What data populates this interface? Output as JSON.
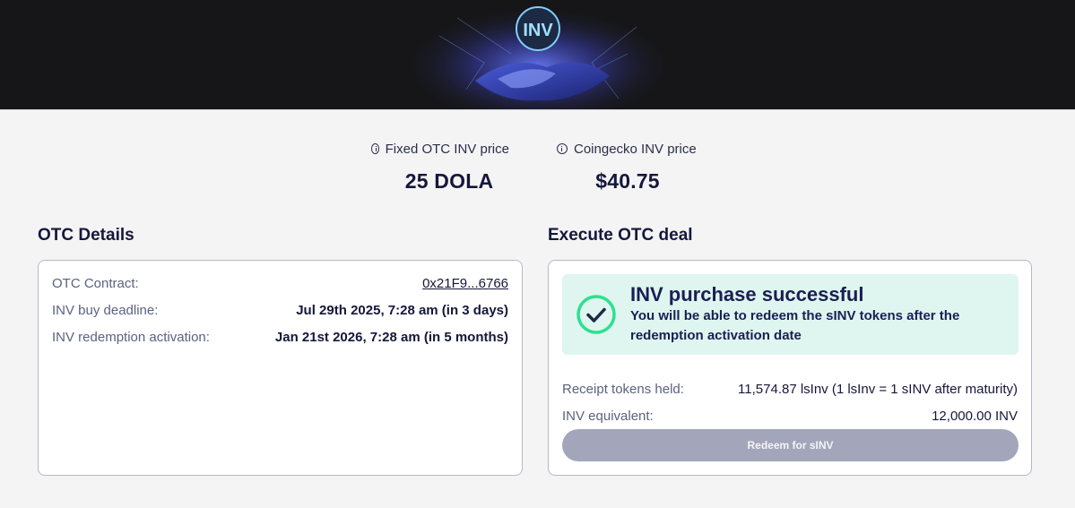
{
  "banner": {
    "icon": "handshake-logo-banner"
  },
  "prices": [
    {
      "label": "Fixed OTC INV price",
      "value": "25 DOLA",
      "icon": "info-icon"
    },
    {
      "label": "Coingecko INV price",
      "value": "$40.75",
      "icon": "info-icon"
    }
  ],
  "otc_details": {
    "title": "OTC Details",
    "rows": [
      {
        "label": "OTC Contract:",
        "value": "0x21F9...6766"
      },
      {
        "label": "INV buy deadline:",
        "value": "Jul 29th 2025, 7:28 am (in 3 days)"
      },
      {
        "label": "INV redemption activation:",
        "value": "Jan 21st 2026, 7:28 am (in 5 months)"
      }
    ]
  },
  "execute": {
    "title": "Execute OTC deal",
    "success_title": "INV purchase successful",
    "success_message": "You will be able to redeem the sINV tokens after the redemption activation date",
    "success_icon": "check-circle-icon",
    "rows": [
      {
        "label": "Receipt tokens held:",
        "value": "11,574.87 lsInv (1 lsInv = 1 sINV after maturity)"
      },
      {
        "label": "INV equivalent:",
        "value": "12,000.00 INV"
      }
    ],
    "redeem_label": "Redeem for sINV"
  },
  "colors": {
    "background": "#f4f4f5",
    "text": "#15173b",
    "success_bg": "#dff6f0",
    "success_check": "#2ee08f",
    "button_disabled": "#a3a6ba"
  }
}
